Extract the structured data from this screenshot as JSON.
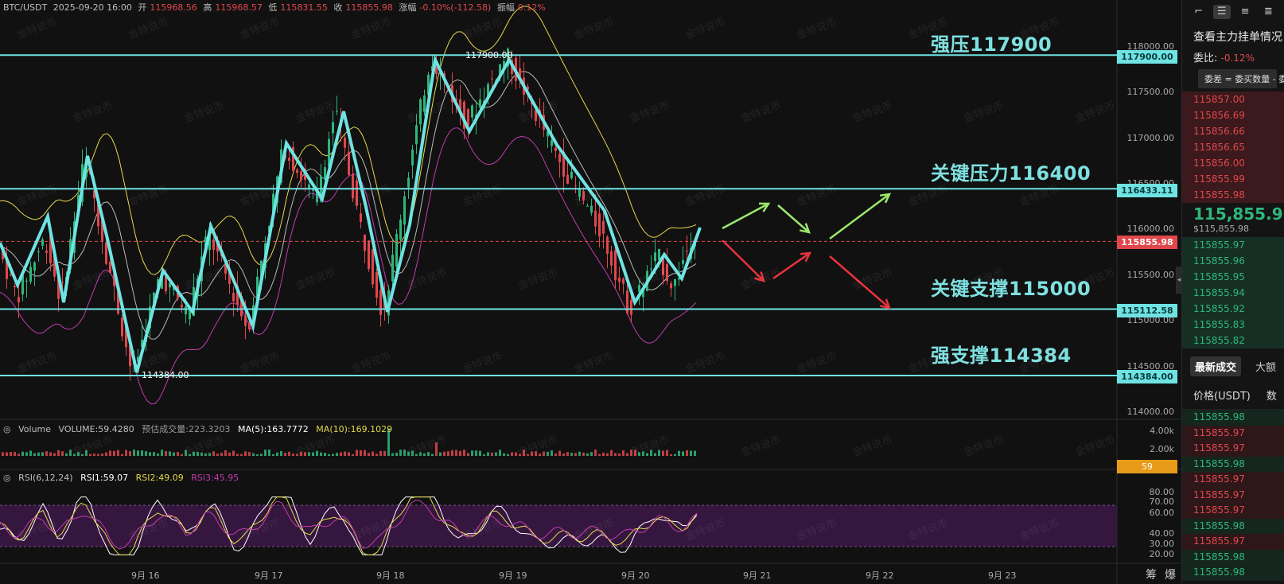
{
  "header": {
    "symbol": "BTC/USDT",
    "datetime": "2025-09-20 16:00",
    "open_label": "开",
    "open": "115968.56",
    "high_label": "高",
    "high": "115968.57",
    "low_label": "低",
    "low": "115831.55",
    "close_label": "收",
    "close": "115855.98",
    "change_label": "涨幅",
    "change": "-0.10%(-112.58)",
    "amp_label": "振幅",
    "amp": "0.12%"
  },
  "price_axis": [
    "118000.00",
    "117500.00",
    "117000.00",
    "116500.00",
    "116000.00",
    "115500.00",
    "115000.00",
    "114500.00",
    "114000.00"
  ],
  "levels": [
    {
      "label": "强压117900",
      "tag": "117900.00",
      "price": 117900
    },
    {
      "label": "关键压力116400",
      "tag": "116433.11",
      "price": 116433.11
    },
    {
      "label": "关键支撑115000",
      "tag": "115112.58",
      "price": 115112.58
    },
    {
      "label": "强支撑114384",
      "tag": "114384.00",
      "price": 114384
    }
  ],
  "current_price_tag": "115855.98",
  "current_price": 115855.98,
  "annotations": {
    "high_marker": "117900.00",
    "low_marker": "114384.00"
  },
  "volume": {
    "title": "Volume",
    "value": "VOLUME:59.4280",
    "estimate": "预估成交量:223.3203",
    "ma5": "MA(5):163.7772",
    "ma10": "MA(10):169.1029",
    "axis": [
      "4.00k",
      "2.00k"
    ],
    "tag": "59"
  },
  "rsi": {
    "title": "RSI(6,12,24)",
    "rsi1": "RSI1:59.07",
    "rsi2": "RSI2:49.09",
    "rsi3": "RSI3:45.95",
    "axis": [
      "80.00",
      "70.00",
      "60.00",
      "40.00",
      "30.00",
      "20.00"
    ]
  },
  "x_axis": [
    "9月 16",
    "9月 17",
    "9月 18",
    "9月 19",
    "9月 20",
    "9月 21",
    "9月 22",
    "9月 23"
  ],
  "bottom_right": [
    "筹",
    "爆"
  ],
  "watermark": "金特说币",
  "colors": {
    "cyan": "#6fe3e3",
    "up": "#2fb67b",
    "down": "#e0474c",
    "bg": "#111111",
    "yellow": "#e6d94a",
    "magenta": "#c23bb0"
  },
  "side_panel": {
    "title": "查看主力挂单情况",
    "ratio_label": "委比:",
    "ratio_value": "-0.12%",
    "tooltip": "委差 = 委买数量 - 委",
    "asks": [
      "115857.00",
      "115856.69",
      "115856.66",
      "115856.65",
      "115856.00",
      "115855.99",
      "115855.98"
    ],
    "last_price": "115,855.98",
    "last_price_usd": "$115,855.98",
    "bids": [
      "115855.97",
      "115855.96",
      "115855.95",
      "115855.94",
      "115855.92",
      "115855.83",
      "115855.82"
    ],
    "tabs": [
      "最新成交",
      "大额"
    ],
    "col_price": "价格(USDT)",
    "col_qty": "数",
    "trades": [
      {
        "p": "115855.98",
        "s": "bid"
      },
      {
        "p": "115855.97",
        "s": "ask"
      },
      {
        "p": "115855.97",
        "s": "ask"
      },
      {
        "p": "115855.98",
        "s": "bid"
      },
      {
        "p": "115855.97",
        "s": "ask"
      },
      {
        "p": "115855.97",
        "s": "ask"
      },
      {
        "p": "115855.97",
        "s": "ask"
      },
      {
        "p": "115855.98",
        "s": "bid"
      },
      {
        "p": "115855.97",
        "s": "ask"
      },
      {
        "p": "115855.98",
        "s": "bid"
      },
      {
        "p": "115855.98",
        "s": "bid"
      }
    ]
  }
}
